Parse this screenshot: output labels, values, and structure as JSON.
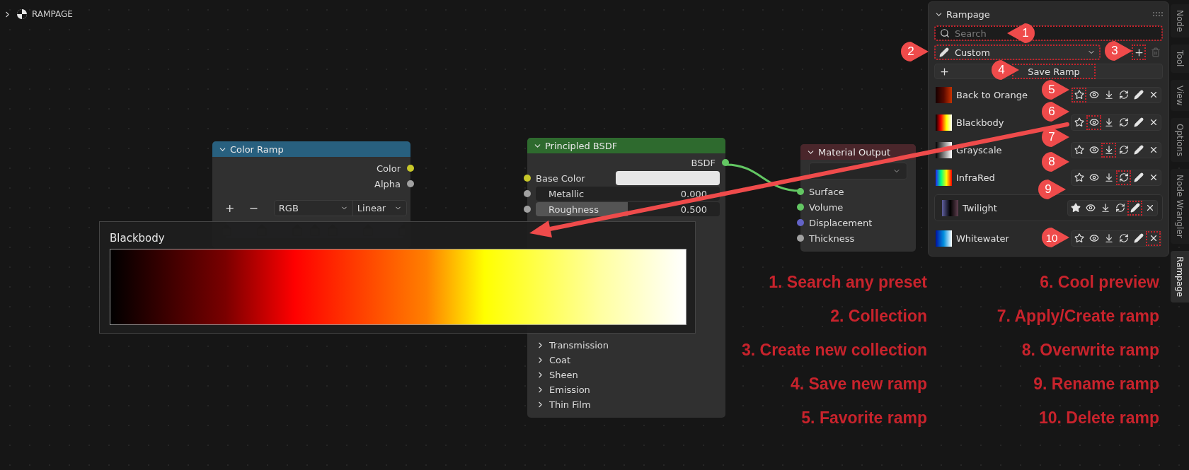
{
  "header": {
    "title": "RAMPAGE"
  },
  "color_ramp_node": {
    "title": "Color Ramp",
    "outputs": [
      {
        "label": "Color",
        "color": "#c7c729"
      },
      {
        "label": "Alpha",
        "color": "#a1a1a1"
      }
    ],
    "controls": [
      "+",
      "−"
    ],
    "color_mode": "RGB",
    "interpolation": "Linear"
  },
  "principled_node": {
    "title": "Principled BSDF",
    "output": {
      "label": "BSDF",
      "color": "#63c763"
    },
    "inputs": [
      {
        "kind": "color",
        "label": "Base Color",
        "color": "#c7c729"
      },
      {
        "kind": "slider",
        "label": "Metallic",
        "value": "0.000",
        "level": 0,
        "color": "#a1a1a1"
      },
      {
        "kind": "slider",
        "label": "Roughness",
        "value": "0.500",
        "level": 0.5,
        "color": "#a1a1a1"
      }
    ],
    "panels": [
      "Transmission",
      "Coat",
      "Sheen",
      "Emission",
      "Thin Film"
    ]
  },
  "material_output_node": {
    "title": "Material Output",
    "inputs": [
      {
        "label": "Surface",
        "color": "#63c763"
      },
      {
        "label": "Volume",
        "color": "#63c763"
      },
      {
        "label": "Displacement",
        "color": "#6363c7"
      },
      {
        "label": "Thickness",
        "color": "#a1a1a1"
      }
    ]
  },
  "tooltip": {
    "title": "Blackbody"
  },
  "panel": {
    "title": "Rampage",
    "search": {
      "placeholder": "Search",
      "outlined": true
    },
    "collection": {
      "value": "Custom",
      "outlined": true
    },
    "add_collection": {
      "outlined": true
    },
    "save_button": {
      "label": "Save Ramp",
      "outlined": true
    },
    "ramps": [
      {
        "name": "Back to Orange",
        "favorite": false,
        "selected": false,
        "buttons": [
          {
            "kind": "star",
            "outlined": true
          },
          {
            "kind": "eye",
            "outlined": false
          },
          {
            "kind": "apply",
            "outlined": false
          },
          {
            "kind": "refresh",
            "outlined": false
          },
          {
            "kind": "rename",
            "outlined": false
          },
          {
            "kind": "delete",
            "outlined": false
          }
        ]
      },
      {
        "name": "Blackbody",
        "favorite": false,
        "selected": false,
        "buttons": [
          {
            "kind": "star",
            "outlined": false
          },
          {
            "kind": "eye",
            "outlined": true
          },
          {
            "kind": "apply",
            "outlined": false
          },
          {
            "kind": "refresh",
            "outlined": false
          },
          {
            "kind": "rename",
            "outlined": false
          },
          {
            "kind": "delete",
            "outlined": false
          }
        ]
      },
      {
        "name": "Grayscale",
        "favorite": false,
        "selected": false,
        "buttons": [
          {
            "kind": "star",
            "outlined": false
          },
          {
            "kind": "eye",
            "outlined": false
          },
          {
            "kind": "apply",
            "outlined": true
          },
          {
            "kind": "refresh",
            "outlined": false
          },
          {
            "kind": "rename",
            "outlined": false
          },
          {
            "kind": "delete",
            "outlined": false
          }
        ]
      },
      {
        "name": "InfraRed",
        "favorite": false,
        "selected": false,
        "buttons": [
          {
            "kind": "star",
            "outlined": false
          },
          {
            "kind": "eye",
            "outlined": false
          },
          {
            "kind": "apply",
            "outlined": false
          },
          {
            "kind": "refresh",
            "outlined": true
          },
          {
            "kind": "rename",
            "outlined": false
          },
          {
            "kind": "delete",
            "outlined": false
          }
        ]
      },
      {
        "name": "Twilight",
        "favorite": true,
        "selected": true,
        "buttons": [
          {
            "kind": "star",
            "outlined": false
          },
          {
            "kind": "eye",
            "outlined": false
          },
          {
            "kind": "apply",
            "outlined": false
          },
          {
            "kind": "refresh",
            "outlined": false
          },
          {
            "kind": "rename",
            "outlined": true
          },
          {
            "kind": "delete",
            "outlined": false
          }
        ]
      },
      {
        "name": "Whitewater",
        "favorite": false,
        "selected": false,
        "buttons": [
          {
            "kind": "star",
            "outlined": false
          },
          {
            "kind": "eye",
            "outlined": false
          },
          {
            "kind": "apply",
            "outlined": false
          },
          {
            "kind": "refresh",
            "outlined": false
          },
          {
            "kind": "rename",
            "outlined": false
          },
          {
            "kind": "delete",
            "outlined": true
          }
        ]
      }
    ]
  },
  "tabs": [
    {
      "label": "Node",
      "selected": false
    },
    {
      "label": "Tool",
      "selected": false
    },
    {
      "label": "View",
      "selected": false
    },
    {
      "label": "Options",
      "selected": false
    },
    {
      "label": "Node Wrangler",
      "selected": false
    },
    {
      "label": "Rampage",
      "selected": true
    }
  ],
  "annotations": {
    "left": [
      "1. Search any preset",
      "2. Collection",
      "3. Create new collection",
      "4. Save new ramp",
      "5. Favorite ramp"
    ],
    "right": [
      "6. Cool preview",
      "7. Apply/Create ramp",
      "8. Overwrite ramp",
      "9. Rename  ramp",
      "10. Delete ramp"
    ]
  },
  "callouts": [
    {
      "number": "1",
      "kind": "left"
    },
    {
      "number": "2",
      "kind": "right"
    },
    {
      "number": "3",
      "kind": "right"
    },
    {
      "number": "4",
      "kind": "right"
    },
    {
      "number": "5",
      "kind": "right"
    },
    {
      "number": "6",
      "kind": "right"
    },
    {
      "number": "7",
      "kind": "right"
    },
    {
      "number": "8",
      "kind": "right"
    },
    {
      "number": "9",
      "kind": "right"
    },
    {
      "number": "10",
      "kind": "right"
    }
  ]
}
